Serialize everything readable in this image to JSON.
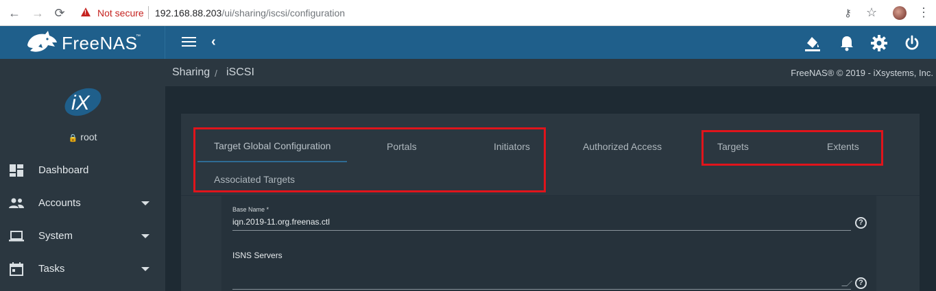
{
  "browser": {
    "security_label": "Not secure",
    "url_host": "192.168.88.203",
    "url_path": "/ui/sharing/iscsi/configuration"
  },
  "topbar": {
    "brand": "FreeNAS",
    "brand_tm": "™"
  },
  "sidebar": {
    "user": "root",
    "items": [
      {
        "label": "Dashboard",
        "icon": "dashboard-icon",
        "has_caret": false
      },
      {
        "label": "Accounts",
        "icon": "people-icon",
        "has_caret": true
      },
      {
        "label": "System",
        "icon": "laptop-icon",
        "has_caret": true
      },
      {
        "label": "Tasks",
        "icon": "calendar-icon",
        "has_caret": true
      }
    ]
  },
  "breadcrumb": {
    "items": [
      "Sharing",
      "iSCSI"
    ],
    "separator": "/"
  },
  "footer": {
    "copyright": "FreeNAS® © 2019 - iXsystems, Inc."
  },
  "tabs": [
    {
      "label": "Target Global Configuration",
      "active": true
    },
    {
      "label": "Portals",
      "active": false
    },
    {
      "label": "Initiators",
      "active": false
    },
    {
      "label": "Authorized Access",
      "active": false
    },
    {
      "label": "Targets",
      "active": false
    },
    {
      "label": "Extents",
      "active": false
    },
    {
      "label": "Associated Targets",
      "active": false
    }
  ],
  "form": {
    "base_name_label": "Base Name *",
    "base_name_value": "iqn.2019-11.org.freenas.ctl",
    "isns_label": "ISNS Servers",
    "isns_value": "",
    "help_symbol": "?"
  },
  "colors": {
    "topbar": "#1f5f8b",
    "sidebar": "#2b3740",
    "background": "#1e2a33",
    "highlight": "#e0141b",
    "warning": "#c5221f"
  }
}
